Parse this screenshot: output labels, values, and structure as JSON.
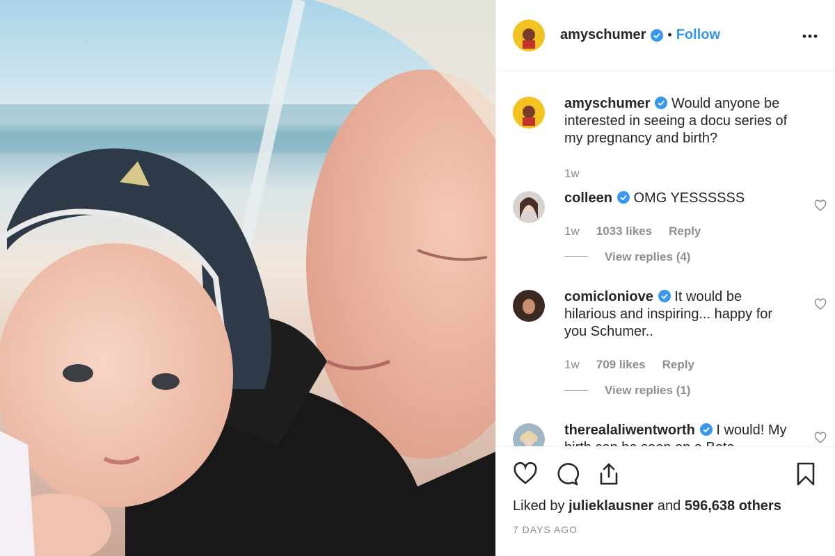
{
  "post": {
    "username": "amyschumer",
    "follow_label": "Follow",
    "separator": "•",
    "more_label": "•••"
  },
  "caption": {
    "username": "amyschumer",
    "text": "Would anyone be interested in seeing a docu series of my pregnancy and birth?",
    "time": "1w"
  },
  "comments": [
    {
      "username": "colleen",
      "text": "OMG YESSSSSS",
      "time": "1w",
      "likes": "1033 likes",
      "reply_label": "Reply",
      "view_replies": "View replies (4)"
    },
    {
      "username": "comicloniove",
      "text": "It would be hilarious and inspiring... happy for you Schumer..",
      "time": "1w",
      "likes": "709 likes",
      "reply_label": "Reply",
      "view_replies": "View replies (1)"
    },
    {
      "username": "therealaliwentworth",
      "text": "I would! My birth can be seen on a Beta"
    }
  ],
  "footer": {
    "liked_by_prefix": "Liked by",
    "liked_by_user": "julieklausner",
    "liked_by_middle": "and",
    "liked_by_count": "596,638 others",
    "posted_ago": "7 DAYS AGO"
  },
  "icons": {
    "like": "heart-icon",
    "comment": "comment-icon",
    "share": "share-icon",
    "save": "bookmark-icon",
    "verified": "verified-badge-icon"
  },
  "colors": {
    "accent": "#3897f0",
    "text": "#262626",
    "muted": "#8e8e8e"
  }
}
